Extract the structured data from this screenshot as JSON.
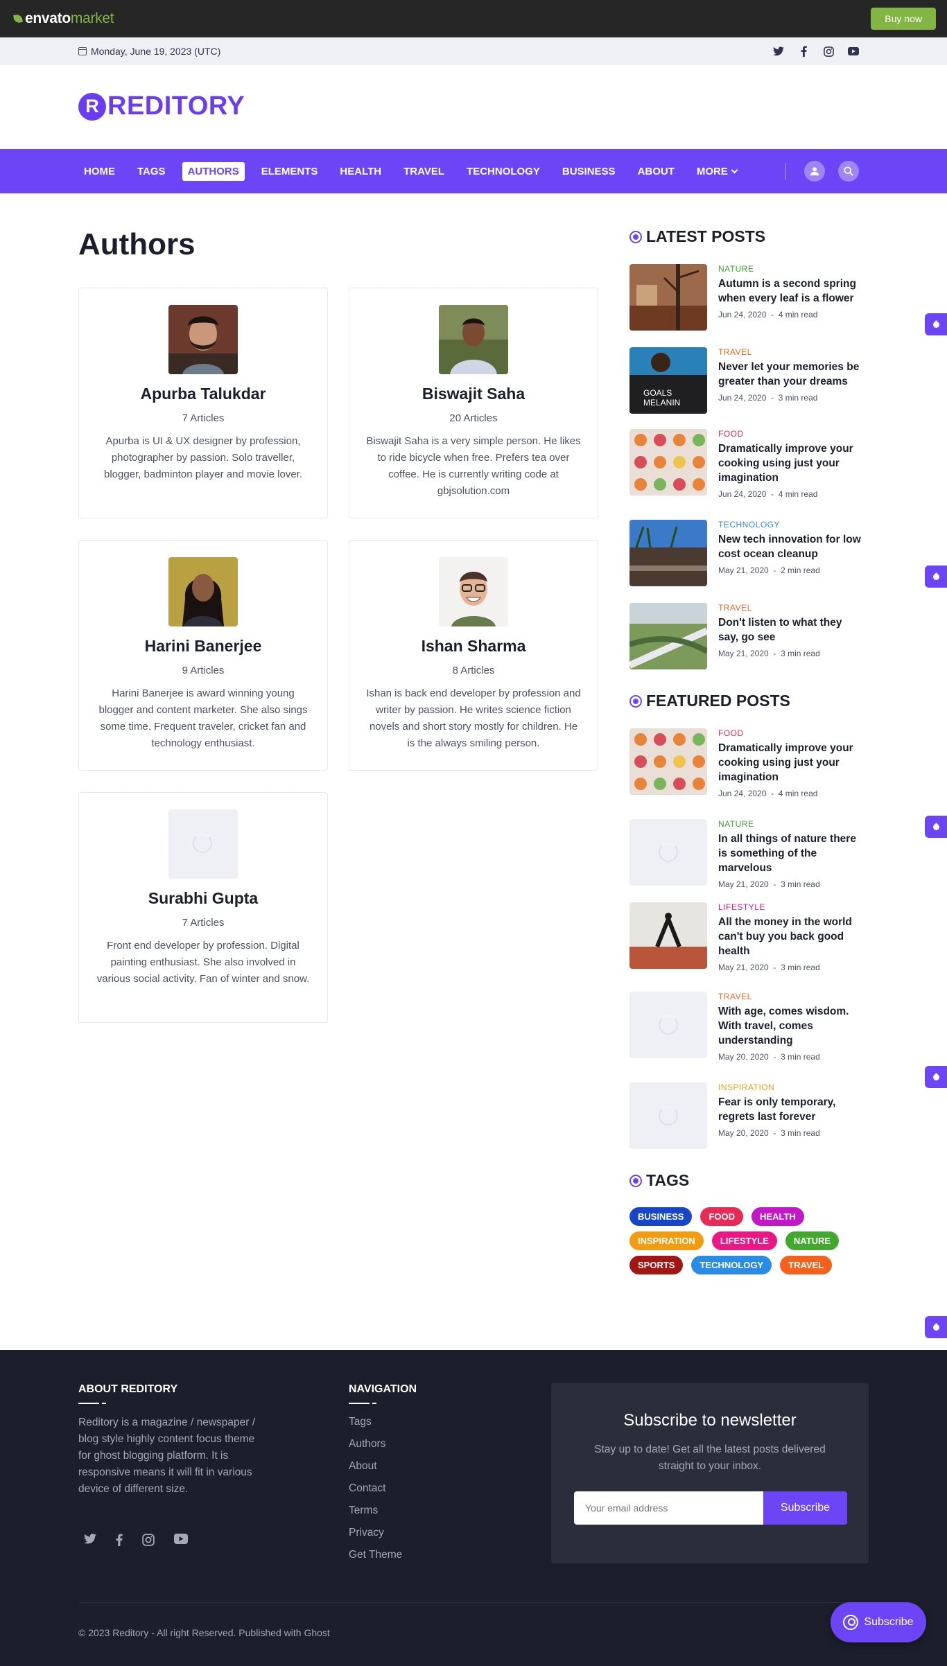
{
  "envato": {
    "logo_main": "envato",
    "logo_sub": "market",
    "buy_label": "Buy now"
  },
  "topbar": {
    "date": "Monday, June 19, 2023 (UTC)"
  },
  "brand": {
    "mark": "R",
    "name": "REDITORY"
  },
  "nav": {
    "items": [
      "HOME",
      "TAGS",
      "AUTHORS",
      "ELEMENTS",
      "HEALTH",
      "TRAVEL",
      "TECHNOLOGY",
      "BUSINESS",
      "ABOUT",
      "MORE"
    ],
    "active": "AUTHORS"
  },
  "page": {
    "title": "Authors"
  },
  "authors": [
    {
      "name": "Apurba Talukdar",
      "count": "7 Articles",
      "bio": "Apurba is UI & UX designer by profession, photographer by passion. Solo traveller, blogger, badminton player and movie lover."
    },
    {
      "name": "Biswajit Saha",
      "count": "20 Articles",
      "bio": "Biswajit Saha is a very simple person. He likes to ride bicycle when free. Prefers tea over coffee. He is currently writing code at gbjsolution.com"
    },
    {
      "name": "Harini Banerjee",
      "count": "9 Articles",
      "bio": "Harini Banerjee is award winning young blogger and content marketer. She also sings some time. Frequent traveler, cricket fan and technology enthusiast."
    },
    {
      "name": "Ishan Sharma",
      "count": "8 Articles",
      "bio": "Ishan is back end developer by profession and writer by passion. He writes science fiction novels and short story mostly for children. He is the always smiling person."
    },
    {
      "name": "Surabhi Gupta",
      "count": "7 Articles",
      "bio": "Front end developer by profession. Digital painting enthusiast. She also involved in various social activity. Fan of winter and snow."
    }
  ],
  "latest": {
    "heading": "LATEST POSTS",
    "posts": [
      {
        "cat": "NATURE",
        "color": "#3fa535",
        "title": "Autumn is a second spring when every leaf is a flower",
        "date": "Jun 24, 2020",
        "read": "4 min read"
      },
      {
        "cat": "TRAVEL",
        "color": "#f2651d",
        "title": "Never let your memories be greater than your dreams",
        "date": "Jun 24, 2020",
        "read": "3 min read"
      },
      {
        "cat": "FOOD",
        "color": "#e8245a",
        "title": "Dramatically improve your cooking using just your imagination",
        "date": "Jun 24, 2020",
        "read": "4 min read"
      },
      {
        "cat": "TECHNOLOGY",
        "color": "#2f8ae6",
        "title": "New tech innovation for low cost ocean cleanup",
        "date": "May 21, 2020",
        "read": "2 min read"
      },
      {
        "cat": "TRAVEL",
        "color": "#f2651d",
        "title": "Don't listen to what they say, go see",
        "date": "May 21, 2020",
        "read": "3 min read"
      }
    ]
  },
  "featured": {
    "heading": "FEATURED POSTS",
    "posts": [
      {
        "cat": "FOOD",
        "color": "#e8245a",
        "title": "Dramatically improve your cooking using just your imagination",
        "date": "Jun 24, 2020",
        "read": "4 min read"
      },
      {
        "cat": "NATURE",
        "color": "#3fa535",
        "title": "In all things of nature there is something of the marvelous",
        "date": "May 21, 2020",
        "read": "3 min read"
      },
      {
        "cat": "LIFESTYLE",
        "color": "#e8128a",
        "title": "All the money in the world can't buy you back good health",
        "date": "May 21, 2020",
        "read": "3 min read"
      },
      {
        "cat": "TRAVEL",
        "color": "#f2651d",
        "title": "With age, comes wisdom. With travel, comes understanding",
        "date": "May 20, 2020",
        "read": "3 min read"
      },
      {
        "cat": "INSPIRATION",
        "color": "#f39c12",
        "title": "Fear is only temporary, regrets last forever",
        "date": "May 20, 2020",
        "read": "3 min read"
      }
    ]
  },
  "tags": {
    "heading": "TAGS",
    "items": [
      {
        "label": "BUSINESS",
        "color": "#1747c8"
      },
      {
        "label": "FOOD",
        "color": "#ea2a56"
      },
      {
        "label": "HEALTH",
        "color": "#c418c8"
      },
      {
        "label": "INSPIRATION",
        "color": "#f39c12"
      },
      {
        "label": "LIFESTYLE",
        "color": "#ec1785"
      },
      {
        "label": "NATURE",
        "color": "#42a92f"
      },
      {
        "label": "SPORTS",
        "color": "#a31614"
      },
      {
        "label": "TECHNOLOGY",
        "color": "#2b8ce6"
      },
      {
        "label": "TRAVEL",
        "color": "#f5611a"
      }
    ]
  },
  "footer": {
    "about_heading": "ABOUT REDITORY",
    "about_text": "Reditory is a magazine / newspaper / blog style highly content focus theme for ghost blogging platform. It is responsive means it will fit in various device of different size.",
    "nav_heading": "NAVIGATION",
    "links": [
      "Tags",
      "Authors",
      "About",
      "Contact",
      "Terms",
      "Privacy",
      "Get Theme"
    ],
    "newsletter_title": "Subscribe to newsletter",
    "newsletter_text": "Stay up to date! Get all the latest posts delivered straight to your inbox.",
    "email_placeholder": "Your email address",
    "subscribe_label": "Subscribe",
    "copyright": "© 2023 Reditory - All right Reserved. Published with Ghost",
    "float_label": "Subscribe"
  },
  "colors": {
    "accent": "#6b45f6",
    "footer_bg": "#1b1f2b",
    "envato_green": "#82b541"
  }
}
